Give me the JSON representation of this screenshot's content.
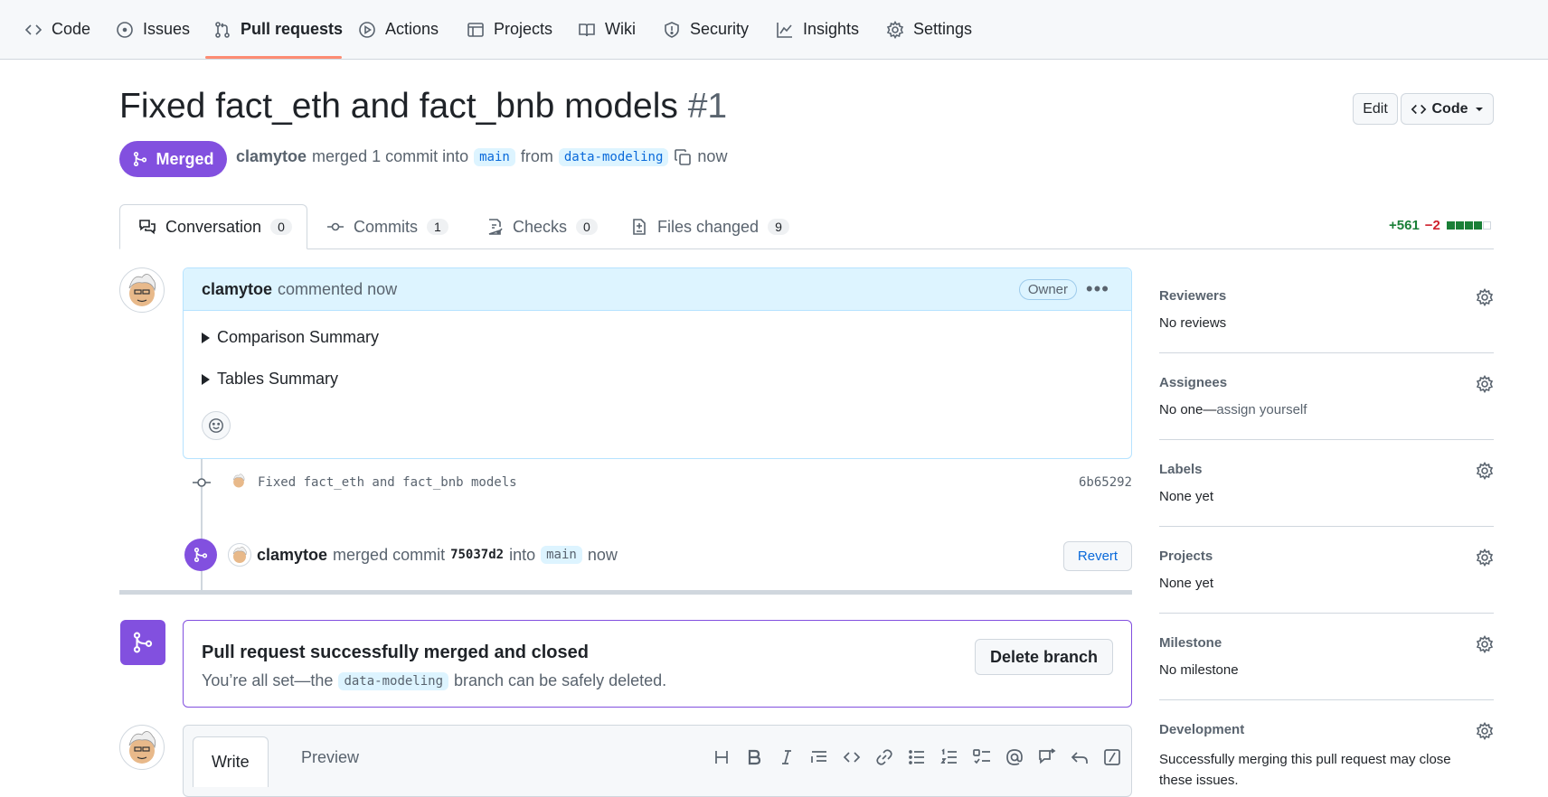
{
  "repo_nav": {
    "tabs": [
      {
        "label": "Code",
        "icon": "code-icon"
      },
      {
        "label": "Issues",
        "icon": "issue-icon"
      },
      {
        "label": "Pull requests",
        "icon": "pull-request-icon",
        "active": true
      },
      {
        "label": "Actions",
        "icon": "play-icon"
      },
      {
        "label": "Projects",
        "icon": "table-icon"
      },
      {
        "label": "Wiki",
        "icon": "book-icon"
      },
      {
        "label": "Security",
        "icon": "shield-icon"
      },
      {
        "label": "Insights",
        "icon": "graph-icon"
      },
      {
        "label": "Settings",
        "icon": "gear-icon"
      }
    ]
  },
  "header": {
    "title": "Fixed fact_eth and fact_bnb models",
    "number": "#1",
    "edit_label": "Edit",
    "code_label": "Code",
    "status": "Merged",
    "author": "clamytoe",
    "merged_text": "merged 1 commit into",
    "base_branch": "main",
    "from_text": "from",
    "head_branch": "data-modeling",
    "time": "now"
  },
  "pr_tabs": [
    {
      "label": "Conversation",
      "count": "0"
    },
    {
      "label": "Commits",
      "count": "1"
    },
    {
      "label": "Checks",
      "count": "0"
    },
    {
      "label": "Files changed",
      "count": "9"
    }
  ],
  "diffstat": {
    "additions": "+561",
    "deletions": "−2"
  },
  "comment": {
    "author": "clamytoe",
    "action": "commented now",
    "badge": "Owner",
    "details": [
      "Comparison Summary",
      "Tables Summary"
    ]
  },
  "commit": {
    "message": "Fixed fact_eth and fact_bnb models",
    "sha": "6b65292"
  },
  "merge_event": {
    "author": "clamytoe",
    "text": "merged commit",
    "sha": "75037d2",
    "into": "into",
    "branch": "main",
    "time": "now",
    "revert_label": "Revert"
  },
  "merge_box": {
    "title": "Pull request successfully merged and closed",
    "text_before": "You’re all set—the",
    "branch": "data-modeling",
    "text_after": "branch can be safely deleted.",
    "button": "Delete branch"
  },
  "editor": {
    "tabs": [
      "Write",
      "Preview"
    ]
  },
  "sidebar": [
    {
      "heading": "Reviewers",
      "value": "No reviews"
    },
    {
      "heading": "Assignees",
      "value": "No one—",
      "link": "assign yourself"
    },
    {
      "heading": "Labels",
      "value": "None yet"
    },
    {
      "heading": "Projects",
      "value": "None yet"
    },
    {
      "heading": "Milestone",
      "value": "No milestone"
    },
    {
      "heading": "Development",
      "value": "Successfully merging this pull request may close these issues."
    }
  ],
  "colors": {
    "merged": "#8250df",
    "accent_underline": "#fd8c73",
    "add": "#1a7f37",
    "del": "#cf222e"
  }
}
